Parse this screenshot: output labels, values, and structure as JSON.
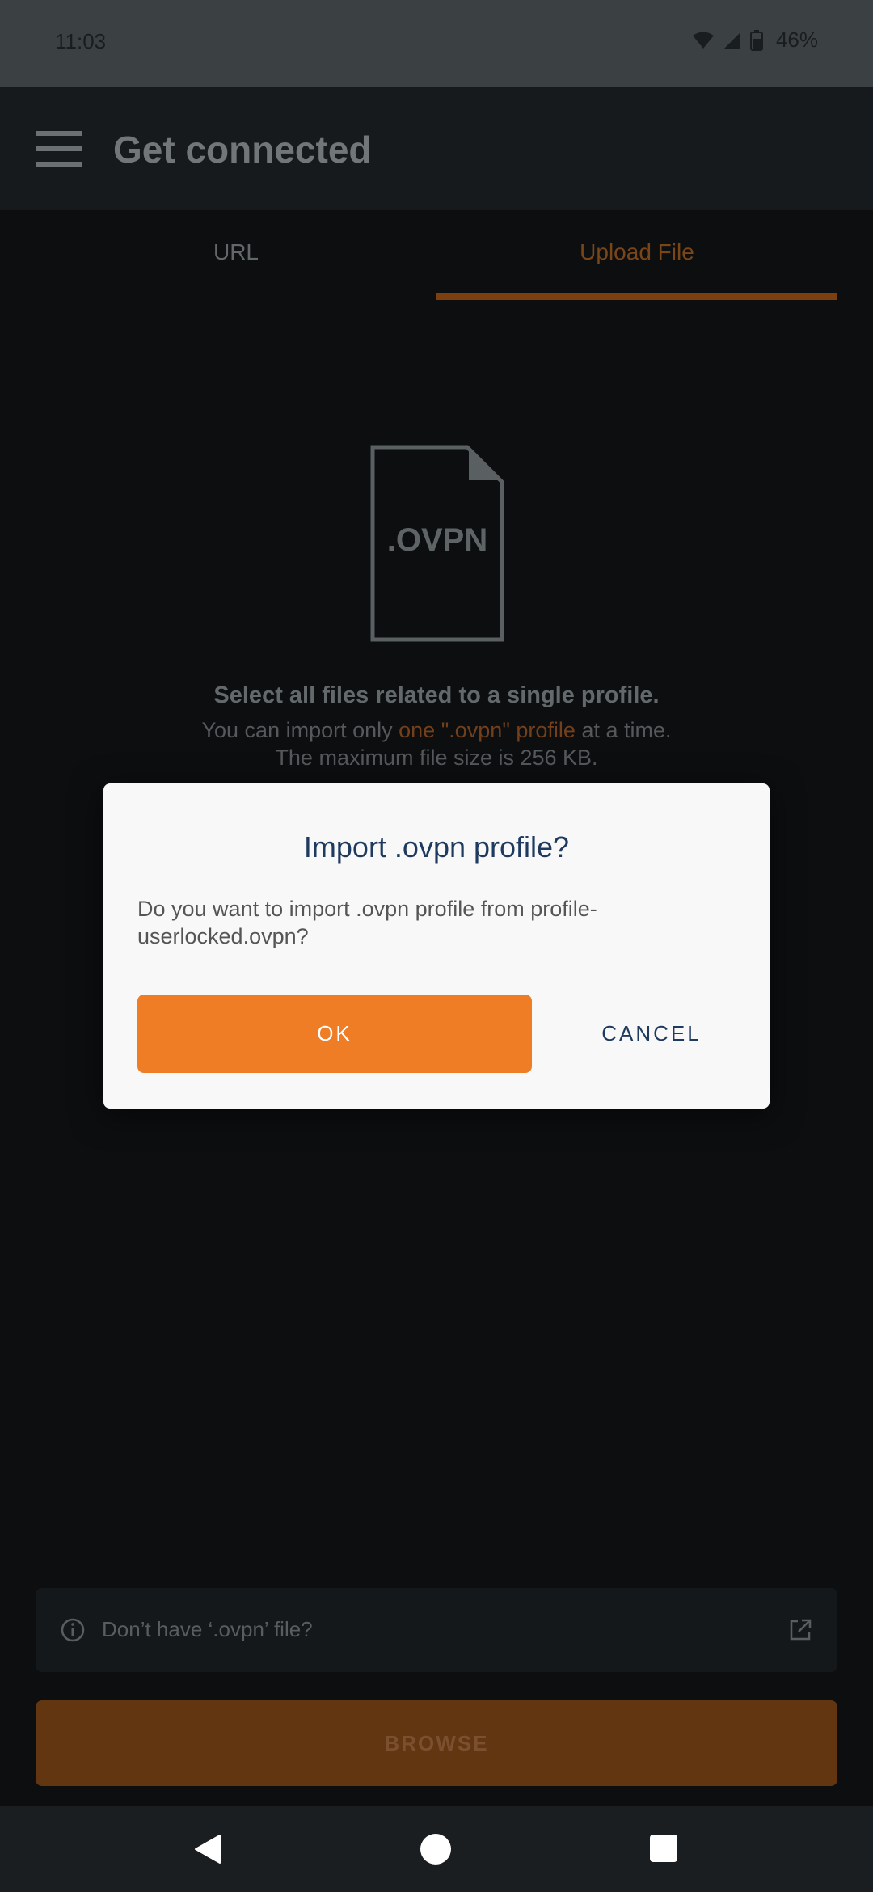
{
  "status_bar": {
    "time": "11:03",
    "battery": "46%"
  },
  "app_bar": {
    "title": "Get connected",
    "menu_icon": "hamburger-menu-icon"
  },
  "tabs": [
    {
      "label": "URL",
      "selected": false
    },
    {
      "label": "Upload File",
      "selected": true
    }
  ],
  "upload": {
    "file_icon_label": ".OVPN",
    "title": "Select all files related to a single profile.",
    "line1_prefix": "You can import only ",
    "line1_accent": "one \".ovpn\" profile",
    "line1_suffix": " at a time.",
    "line2": "The maximum file size is 256 KB."
  },
  "dialog": {
    "title": "Import .ovpn profile?",
    "message": "Do you want to import .ovpn profile from profile-userlocked.ovpn?",
    "ok_label": "OK",
    "cancel_label": "CANCEL"
  },
  "info_card": {
    "text": "Don’t have ‘.ovpn’ file?",
    "icon": "info-icon",
    "action_icon": "external-link-icon"
  },
  "browse_label": "BROWSE",
  "colors": {
    "accent": "#ee7d25",
    "dialog_title": "#1e3a5f",
    "background": "#0c0e10"
  }
}
